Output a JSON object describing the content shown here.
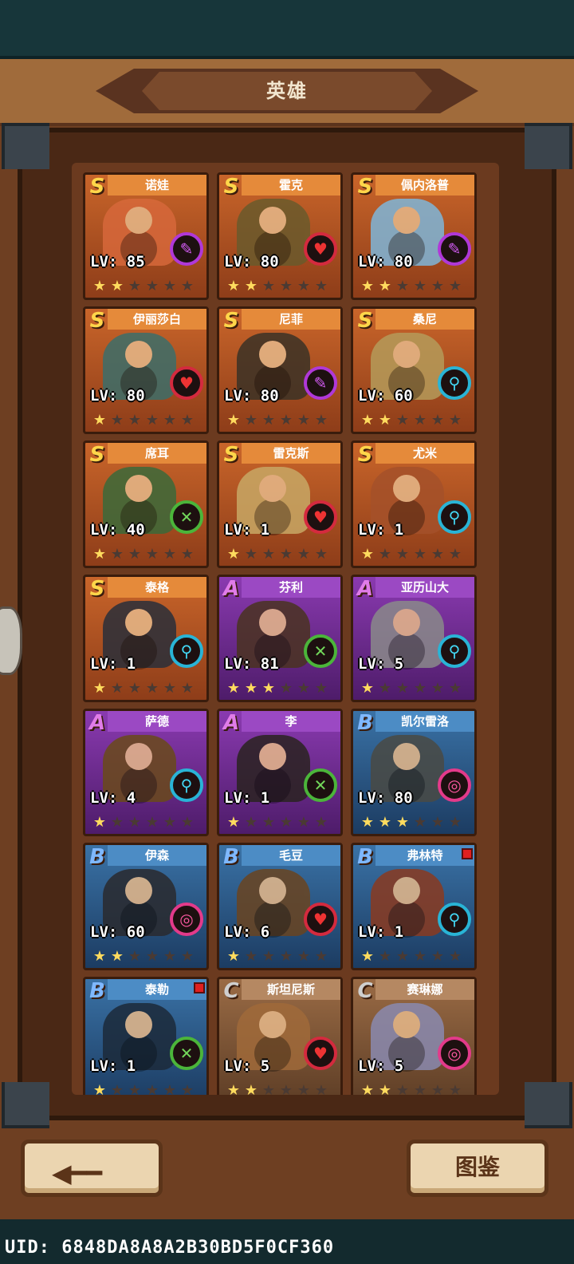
{
  "title": "英雄",
  "heroes": [
    {
      "name": "诺娃",
      "rank": "S",
      "lv": "LV: 85",
      "role": "magic",
      "stars": 2,
      "color": "#d7683b",
      "badge": false
    },
    {
      "name": "霍克",
      "rank": "S",
      "lv": "LV: 80",
      "role": "attack",
      "stars": 2,
      "color": "#6a5a2c",
      "badge": false
    },
    {
      "name": "佩内洛普",
      "rank": "S",
      "lv": "LV: 80",
      "role": "magic",
      "stars": 2,
      "color": "#7fb6d9",
      "badge": false
    },
    {
      "name": "伊丽莎白",
      "rank": "S",
      "lv": "LV: 80",
      "role": "attack",
      "stars": 1,
      "color": "#3c6e6a",
      "badge": false
    },
    {
      "name": "尼菲",
      "rank": "S",
      "lv": "LV: 80",
      "role": "magic",
      "stars": 1,
      "color": "#3b3226",
      "badge": false
    },
    {
      "name": "桑尼",
      "rank": "S",
      "lv": "LV: 60",
      "role": "support",
      "stars": 2,
      "color": "#b59b5a",
      "badge": false
    },
    {
      "name": "席耳",
      "rank": "S",
      "lv": "LV: 40",
      "role": "range",
      "stars": 1,
      "color": "#3b6a3a",
      "badge": false
    },
    {
      "name": "雷克斯",
      "rank": "S",
      "lv": "LV: 1",
      "role": "attack",
      "stars": 1,
      "color": "#c8a865",
      "badge": false
    },
    {
      "name": "尤米",
      "rank": "S",
      "lv": "LV: 1",
      "role": "support",
      "stars": 1,
      "color": "#a5512a",
      "badge": false
    },
    {
      "name": "泰格",
      "rank": "S",
      "lv": "LV: 1",
      "role": "support",
      "stars": 1,
      "color": "#2a2f3a",
      "badge": false
    },
    {
      "name": "芬利",
      "rank": "A",
      "lv": "LV: 81",
      "role": "range",
      "stars": 3,
      "color": "#4a3320",
      "badge": false
    },
    {
      "name": "亚历山大",
      "rank": "A",
      "lv": "LV: 5",
      "role": "support",
      "stars": 1,
      "color": "#8a8a8a",
      "badge": false
    },
    {
      "name": "萨德",
      "rank": "A",
      "lv": "LV: 4",
      "role": "support",
      "stars": 1,
      "color": "#6a4a1a",
      "badge": false
    },
    {
      "name": "李",
      "rank": "A",
      "lv": "LV: 1",
      "role": "range",
      "stars": 1,
      "color": "#2a2320",
      "badge": false
    },
    {
      "name": "凯尔雷洛",
      "rank": "B",
      "lv": "LV: 80",
      "role": "healer",
      "stars": 3,
      "color": "#4a4a44",
      "badge": false
    },
    {
      "name": "伊森",
      "rank": "B",
      "lv": "LV: 60",
      "role": "healer",
      "stars": 2,
      "color": "#2a2a2e",
      "badge": false
    },
    {
      "name": "毛豆",
      "rank": "B",
      "lv": "LV: 6",
      "role": "attack",
      "stars": 1,
      "color": "#6a4420",
      "badge": false
    },
    {
      "name": "弗林特",
      "rank": "B",
      "lv": "LV: 1",
      "role": "support",
      "stars": 1,
      "color": "#8a3a20",
      "badge": true
    },
    {
      "name": "泰勒",
      "rank": "B",
      "lv": "LV: 1",
      "role": "range",
      "stars": 1,
      "color": "#1c2a3a",
      "badge": true
    },
    {
      "name": "斯坦尼斯",
      "rank": "C",
      "lv": "LV: 5",
      "role": "attack",
      "stars": 2,
      "color": "#a06a3a",
      "badge": false
    },
    {
      "name": "赛琳娜",
      "rank": "C",
      "lv": "LV: 5",
      "role": "healer",
      "stars": 2,
      "color": "#8a8ab0",
      "badge": false
    }
  ],
  "max_stars": 6,
  "buttons": {
    "back": "back-arrow",
    "dex": "图鉴"
  },
  "uid": "UID: 6848DA8A8A2B30BD5F0CF360"
}
